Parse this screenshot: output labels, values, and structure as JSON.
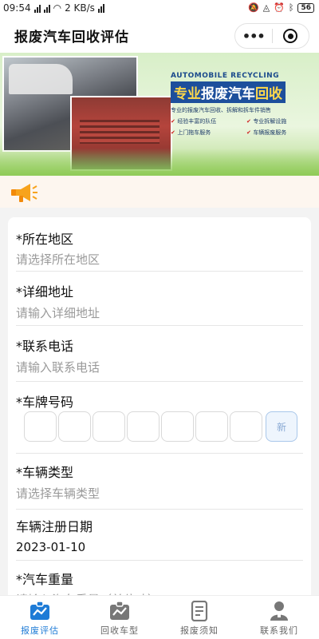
{
  "status_bar": {
    "time": "09:54",
    "network_speed": "2 KB/s",
    "battery_level": "56"
  },
  "header": {
    "title": "报废汽车回收评估",
    "more_icon": "more-dots-icon",
    "close_icon": "target-circle-icon"
  },
  "banner": {
    "en_title": "AUTOMOBILE RECYCLING",
    "cn_title_a": "专业",
    "cn_title_b": "报废汽车",
    "cn_title_c": "回收",
    "slogan": "专业的报废汽车回收、拆解和拆车件销售",
    "features": [
      "经验丰富的队伍",
      "专业拆解设施",
      "上门拖车服务",
      "车辆报废服务"
    ]
  },
  "form": {
    "region": {
      "label": "*所在地区",
      "placeholder": "请选择所在地区"
    },
    "address": {
      "label": "*详细地址",
      "placeholder": "请输入详细地址"
    },
    "phone": {
      "label": "*联系电话",
      "placeholder": "请输入联系电话"
    },
    "plate": {
      "label": "*车牌号码",
      "new_label": "新"
    },
    "vehicle_type": {
      "label": "*车辆类型",
      "placeholder": "请选择车辆类型"
    },
    "reg_date": {
      "label": "车辆注册日期",
      "value": "2023-01-10"
    },
    "weight": {
      "label": "*汽车重量",
      "placeholder": "请输入汽车重量（单位吨）"
    }
  },
  "tabbar": {
    "active_color": "#1e7bd6",
    "tabs": [
      {
        "label": "报废评估",
        "icon": "chart-board-icon"
      },
      {
        "label": "回收车型",
        "icon": "chart-board-icon"
      },
      {
        "label": "报废须知",
        "icon": "document-icon"
      },
      {
        "label": "联系我们",
        "icon": "person-icon"
      }
    ]
  }
}
